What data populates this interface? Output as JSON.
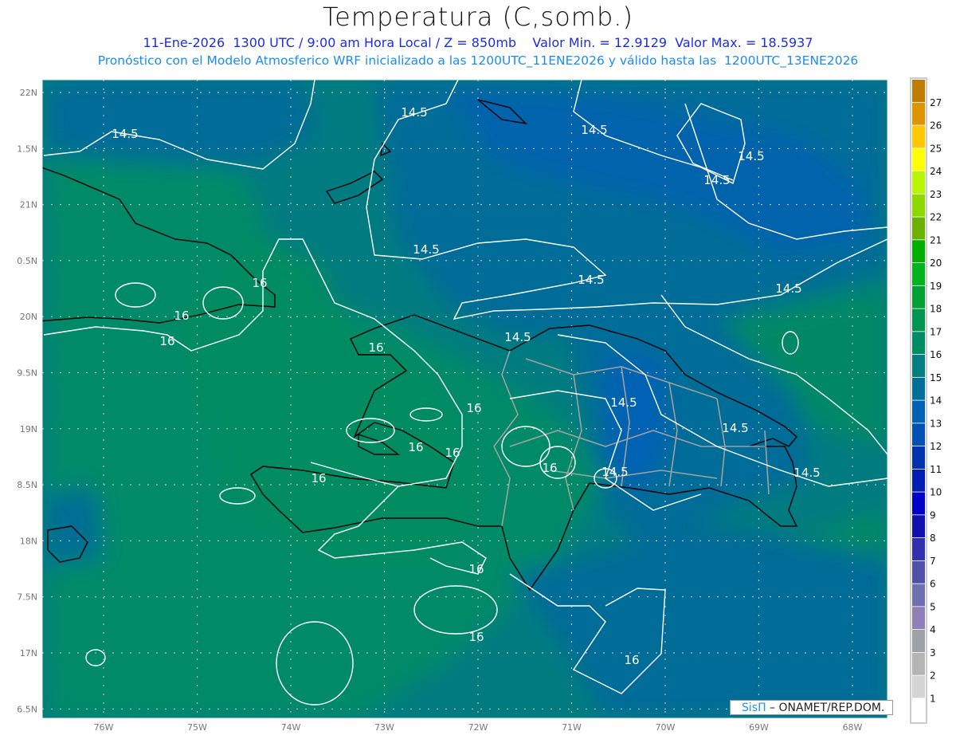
{
  "header": {
    "title": "Temperatura (C,somb.)",
    "line1": "11-Ene-2026  1300 UTC / 9:00 am Hora Local / Z = 850mb    Valor Min. = 12.9129  Valor Max. = 18.5937",
    "line2": "Pronóstico con el Modelo Atmosferico WRF inicializado a las 1200UTC_11ENE2026 y válido hasta las  1200UTC_13ENE2026"
  },
  "axes": {
    "lat_labels": [
      "22N",
      "1.5N",
      "21N",
      "0.5N",
      "20N",
      "9.5N",
      "19N",
      "8.5N",
      "18N",
      "7.5N",
      "17N",
      "6.5N"
    ],
    "lon_labels": [
      "76W",
      "75W",
      "74W",
      "73W",
      "72W",
      "71W",
      "70W",
      "69W",
      "68W"
    ]
  },
  "contour_labels": [
    "14.5",
    "14.5",
    "14.5",
    "14.5",
    "14.5",
    "14.5",
    "14.5",
    "14.5",
    "14.5",
    "14.5",
    "14.5",
    "14.5",
    "14.5",
    "16",
    "16",
    "16",
    "16",
    "16",
    "16",
    "16",
    "16",
    "16",
    "16",
    "16",
    "16"
  ],
  "colorbar": {
    "labels": [
      "27",
      "26",
      "25",
      "24",
      "23",
      "22",
      "21",
      "20",
      "19",
      "18",
      "17",
      "16",
      "15",
      "14",
      "13",
      "12",
      "11",
      "10",
      "9",
      "8",
      "7",
      "6",
      "5",
      "4",
      "3",
      "2",
      "1"
    ],
    "colors": [
      "#c07c00",
      "#de9600",
      "#ffc800",
      "#ffff00",
      "#b9f500",
      "#8ed800",
      "#6cb100",
      "#00b000",
      "#00b41e",
      "#00a032",
      "#009650",
      "#008c64",
      "#008080",
      "#00709a",
      "#0062b4",
      "#0050b8",
      "#0032b0",
      "#001eb4",
      "#0000c8",
      "#1010b0",
      "#3030b0",
      "#5050a8",
      "#7070b0",
      "#9080b8",
      "#a0a0a8",
      "#b4b4b4",
      "#d4d4d4",
      "#ffffff"
    ]
  },
  "credit": {
    "logo": "SisΠ",
    "text": " – ONAMET/REP.DOM."
  }
}
